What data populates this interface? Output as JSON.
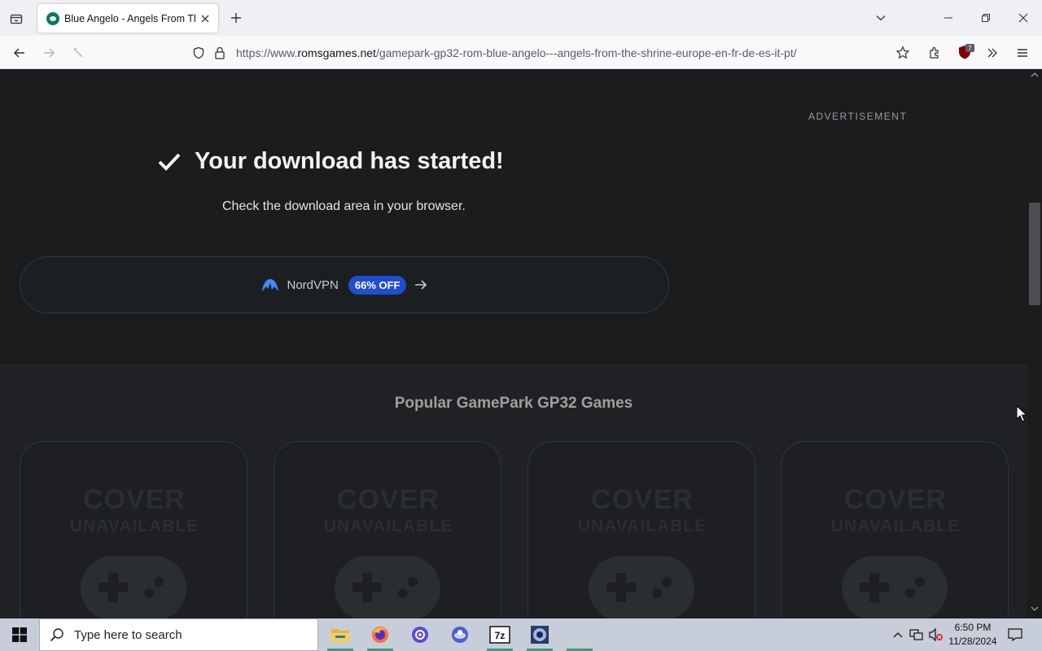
{
  "browser": {
    "tab": {
      "title": "Blue Angelo - Angels From The Shrine"
    },
    "url": {
      "prefix": "https://www.",
      "domain": "romsgames.net",
      "path": "/gamepark-gp32-rom-blue-angelo---angels-from-the-shrine-europe-en-fr-de-es-it-pt/"
    },
    "extension_badge_count": "7"
  },
  "page": {
    "advertisement_label": "ADVERTISEMENT",
    "download_title": "Your download has started!",
    "download_subtitle": "Check the download area in your browser.",
    "promo": {
      "brand": "NordVPN",
      "discount": "66% OFF"
    },
    "popular": {
      "heading": "Popular GamePark GP32 Games",
      "cards": [
        {
          "cover_line1": "COVER",
          "cover_line2": "UNAVAILABLE"
        },
        {
          "cover_line1": "COVER",
          "cover_line2": "UNAVAILABLE"
        },
        {
          "cover_line1": "COVER",
          "cover_line2": "UNAVAILABLE"
        },
        {
          "cover_line1": "COVER",
          "cover_line2": "UNAVAILABLE"
        }
      ]
    }
  },
  "taskbar": {
    "search_placeholder": "Type here to search",
    "time": "6:50 PM",
    "date": "11/28/2024",
    "apps": [
      "file-explorer",
      "firefox",
      "app-purple",
      "app-blue",
      "7zip",
      "app-camera"
    ]
  },
  "colors": {
    "page_bg": "#1b1c1e",
    "badge_blue": "#1f4fd0",
    "taskbar_bg": "#c7cdd9"
  }
}
